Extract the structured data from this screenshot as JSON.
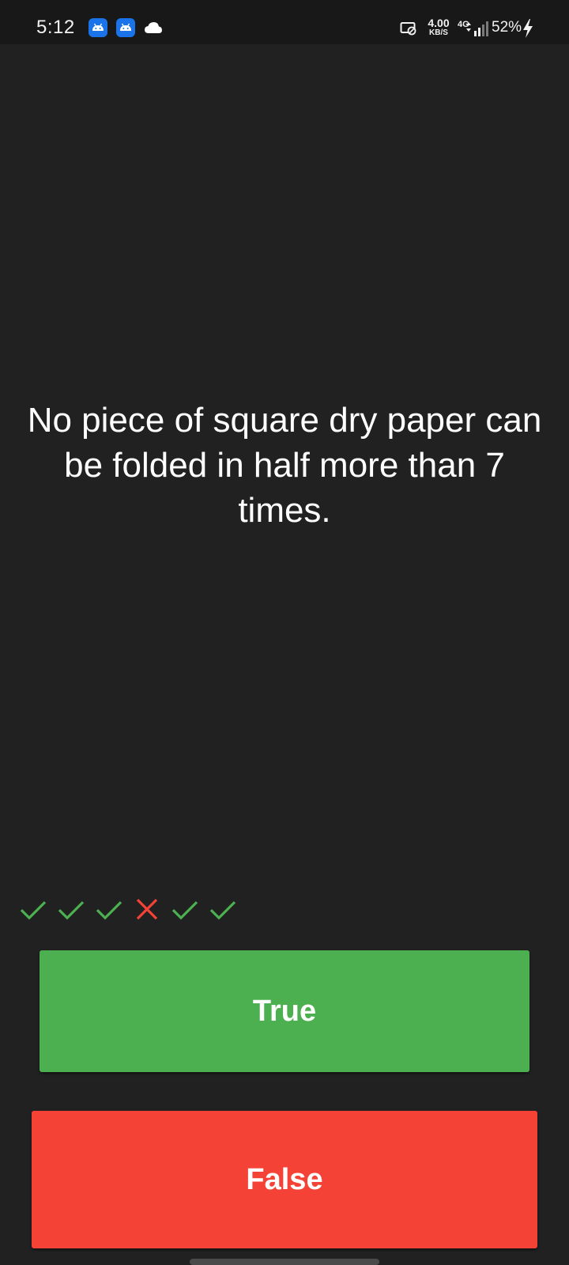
{
  "status_bar": {
    "time": "5:12",
    "notification_icons": [
      "android-app-icon",
      "android-app-icon",
      "cloud-icon"
    ],
    "net_speed_value": "4.00",
    "net_speed_unit": "KB/S",
    "network_type": "4G",
    "battery": "52%",
    "charging": true
  },
  "question": {
    "text": "No piece of square dry paper can be folded in half more than 7 times."
  },
  "score_history": [
    {
      "result": "correct",
      "icon": "check-icon"
    },
    {
      "result": "correct",
      "icon": "check-icon"
    },
    {
      "result": "correct",
      "icon": "check-icon"
    },
    {
      "result": "wrong",
      "icon": "cross-icon"
    },
    {
      "result": "correct",
      "icon": "check-icon"
    },
    {
      "result": "correct",
      "icon": "check-icon"
    }
  ],
  "buttons": {
    "true_label": "True",
    "false_label": "False"
  },
  "colors": {
    "background": "#212121",
    "true_button": "#4caf50",
    "false_button": "#f44336",
    "correct_mark": "#4caf50",
    "wrong_mark": "#f44336"
  }
}
